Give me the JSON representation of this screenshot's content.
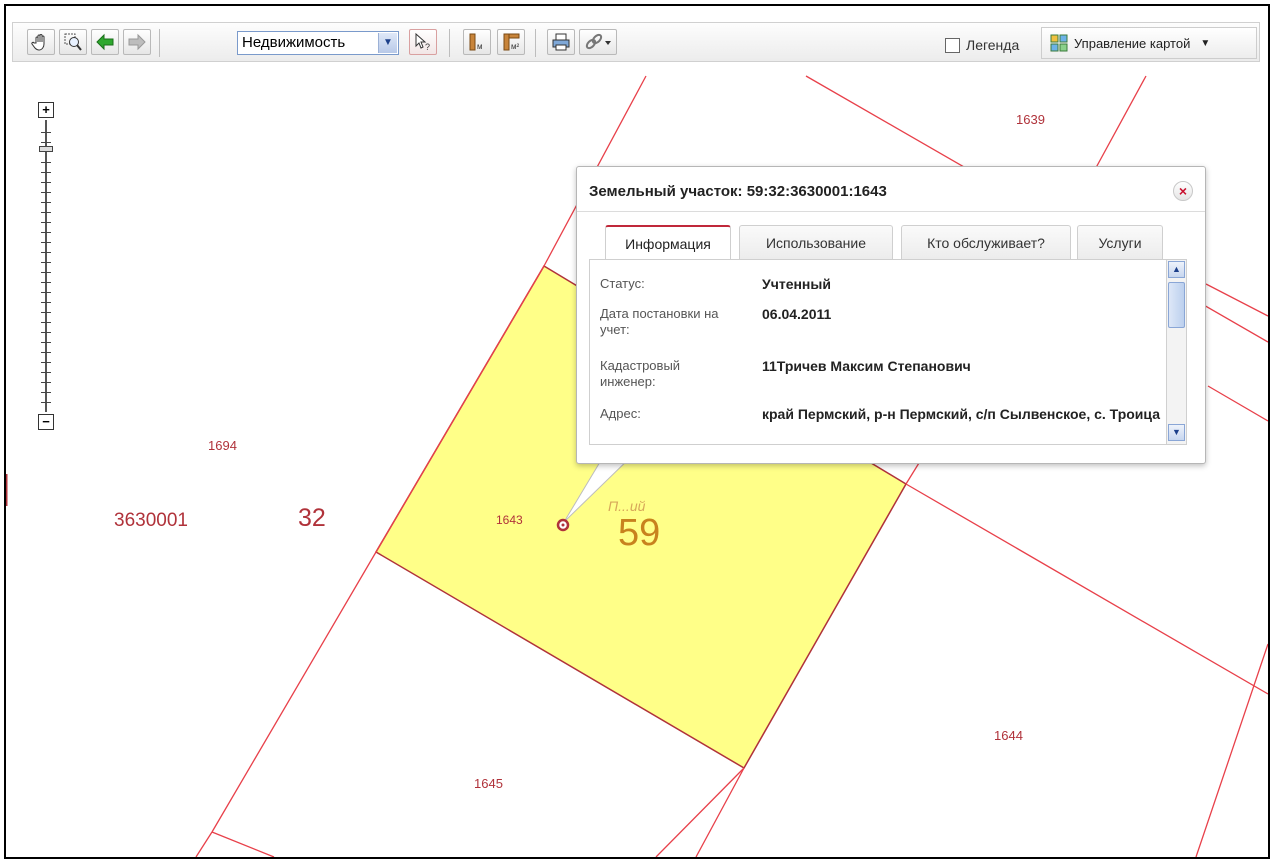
{
  "toolbar": {
    "layer_select_value": "Недвижимость",
    "legend_label": "Легенда",
    "map_control_label": "Управление картой"
  },
  "map": {
    "parcels": {
      "p1639": "1639",
      "p1694": "1694",
      "p1643": "1643",
      "p1644": "1644",
      "p1645": "1645"
    },
    "quarter_number": "3630001",
    "district_number": "32",
    "region_number": "59",
    "region_caption": "П...ий"
  },
  "popup": {
    "title": "Земельный участок: 59:32:3630001:1643",
    "close_glyph": "×",
    "tabs": [
      "Информация",
      "Использование",
      "Кто обслуживает?",
      "Услуги"
    ],
    "rows": [
      {
        "label": "Статус:",
        "value": "Учтенный"
      },
      {
        "label": "Дата постановки на учет:",
        "value": "06.04.2011"
      },
      {
        "label": "Кадастровый инженер:",
        "value": "11Тричев Максим Степанович"
      },
      {
        "label": "Адрес:",
        "value": "край Пермский, р-н Пермский, с/п Сылвенское, с. Троица"
      }
    ]
  },
  "colors": {
    "parcel_line": "#e8404a",
    "selected_fill": "#ffff88",
    "label": "#b0323a",
    "tab_accent": "#c0283a"
  },
  "icons": [
    "pan-hand-icon",
    "zoom-box-icon",
    "back-arrow-icon",
    "forward-arrow-icon",
    "identify-pointer-icon",
    "measure-distance-icon",
    "measure-area-icon",
    "print-icon",
    "link-icon",
    "map-control-grid-icon"
  ]
}
